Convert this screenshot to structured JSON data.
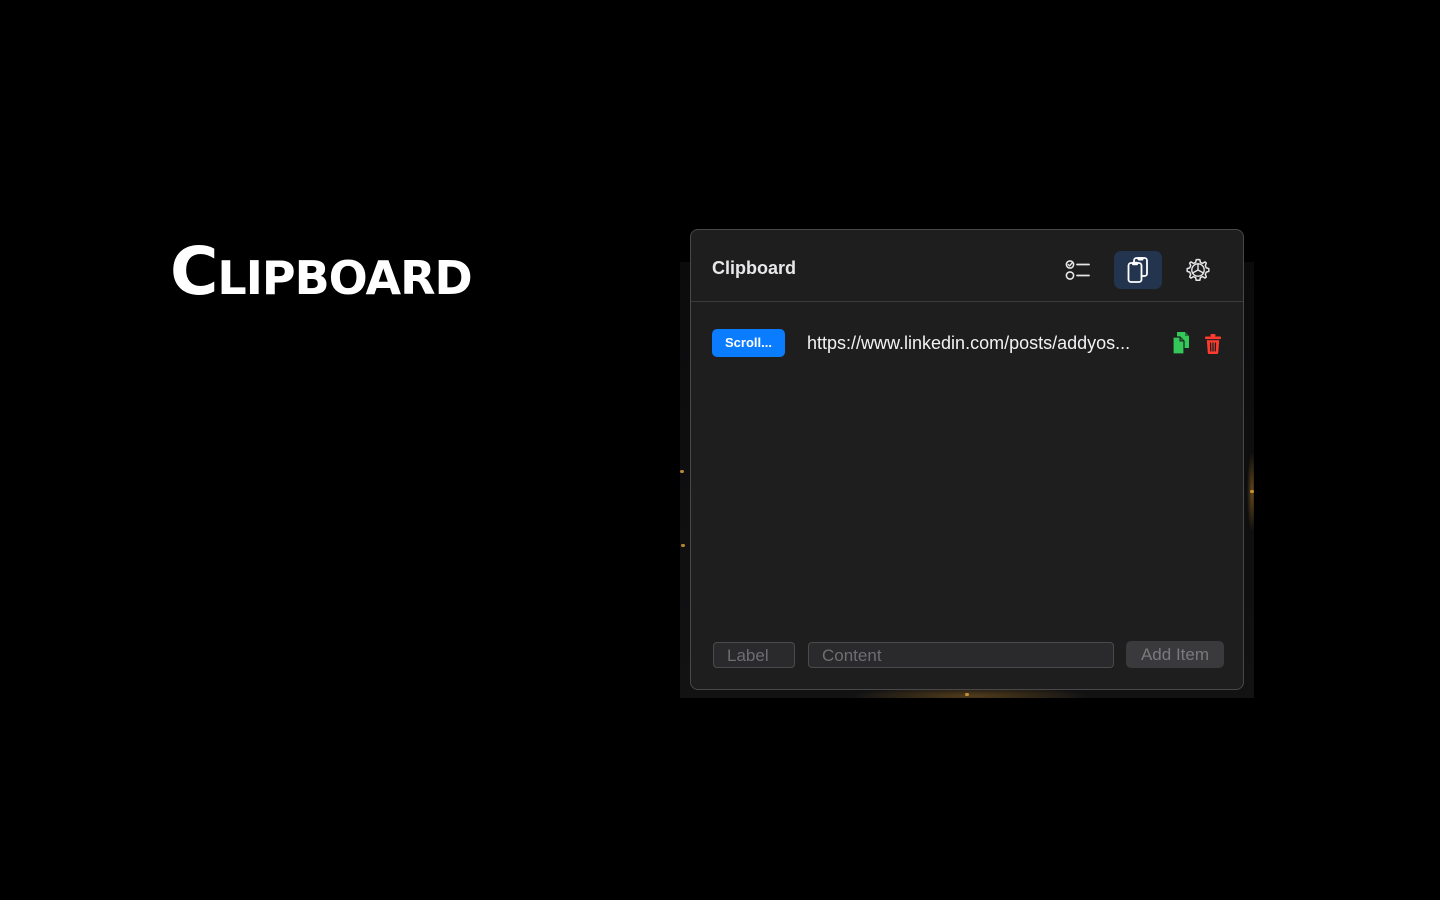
{
  "hero": {
    "title": "Clipboard"
  },
  "panel": {
    "title": "Clipboard",
    "header_buttons": [
      {
        "icon": "checklist-icon",
        "active": false
      },
      {
        "icon": "clipboard-icon",
        "active": true
      },
      {
        "icon": "gear-icon",
        "active": false
      }
    ]
  },
  "items": [
    {
      "label": "Scroll...",
      "content": "https://www.linkedin.com/posts/addyos..."
    }
  ],
  "footer": {
    "label_placeholder": "Label",
    "content_placeholder": "Content",
    "add_button": "Add Item"
  },
  "colors": {
    "badge": "#0a7cff",
    "copy_icon": "#34c759",
    "delete_icon": "#ff3b30",
    "active_tab": "#23344f"
  }
}
